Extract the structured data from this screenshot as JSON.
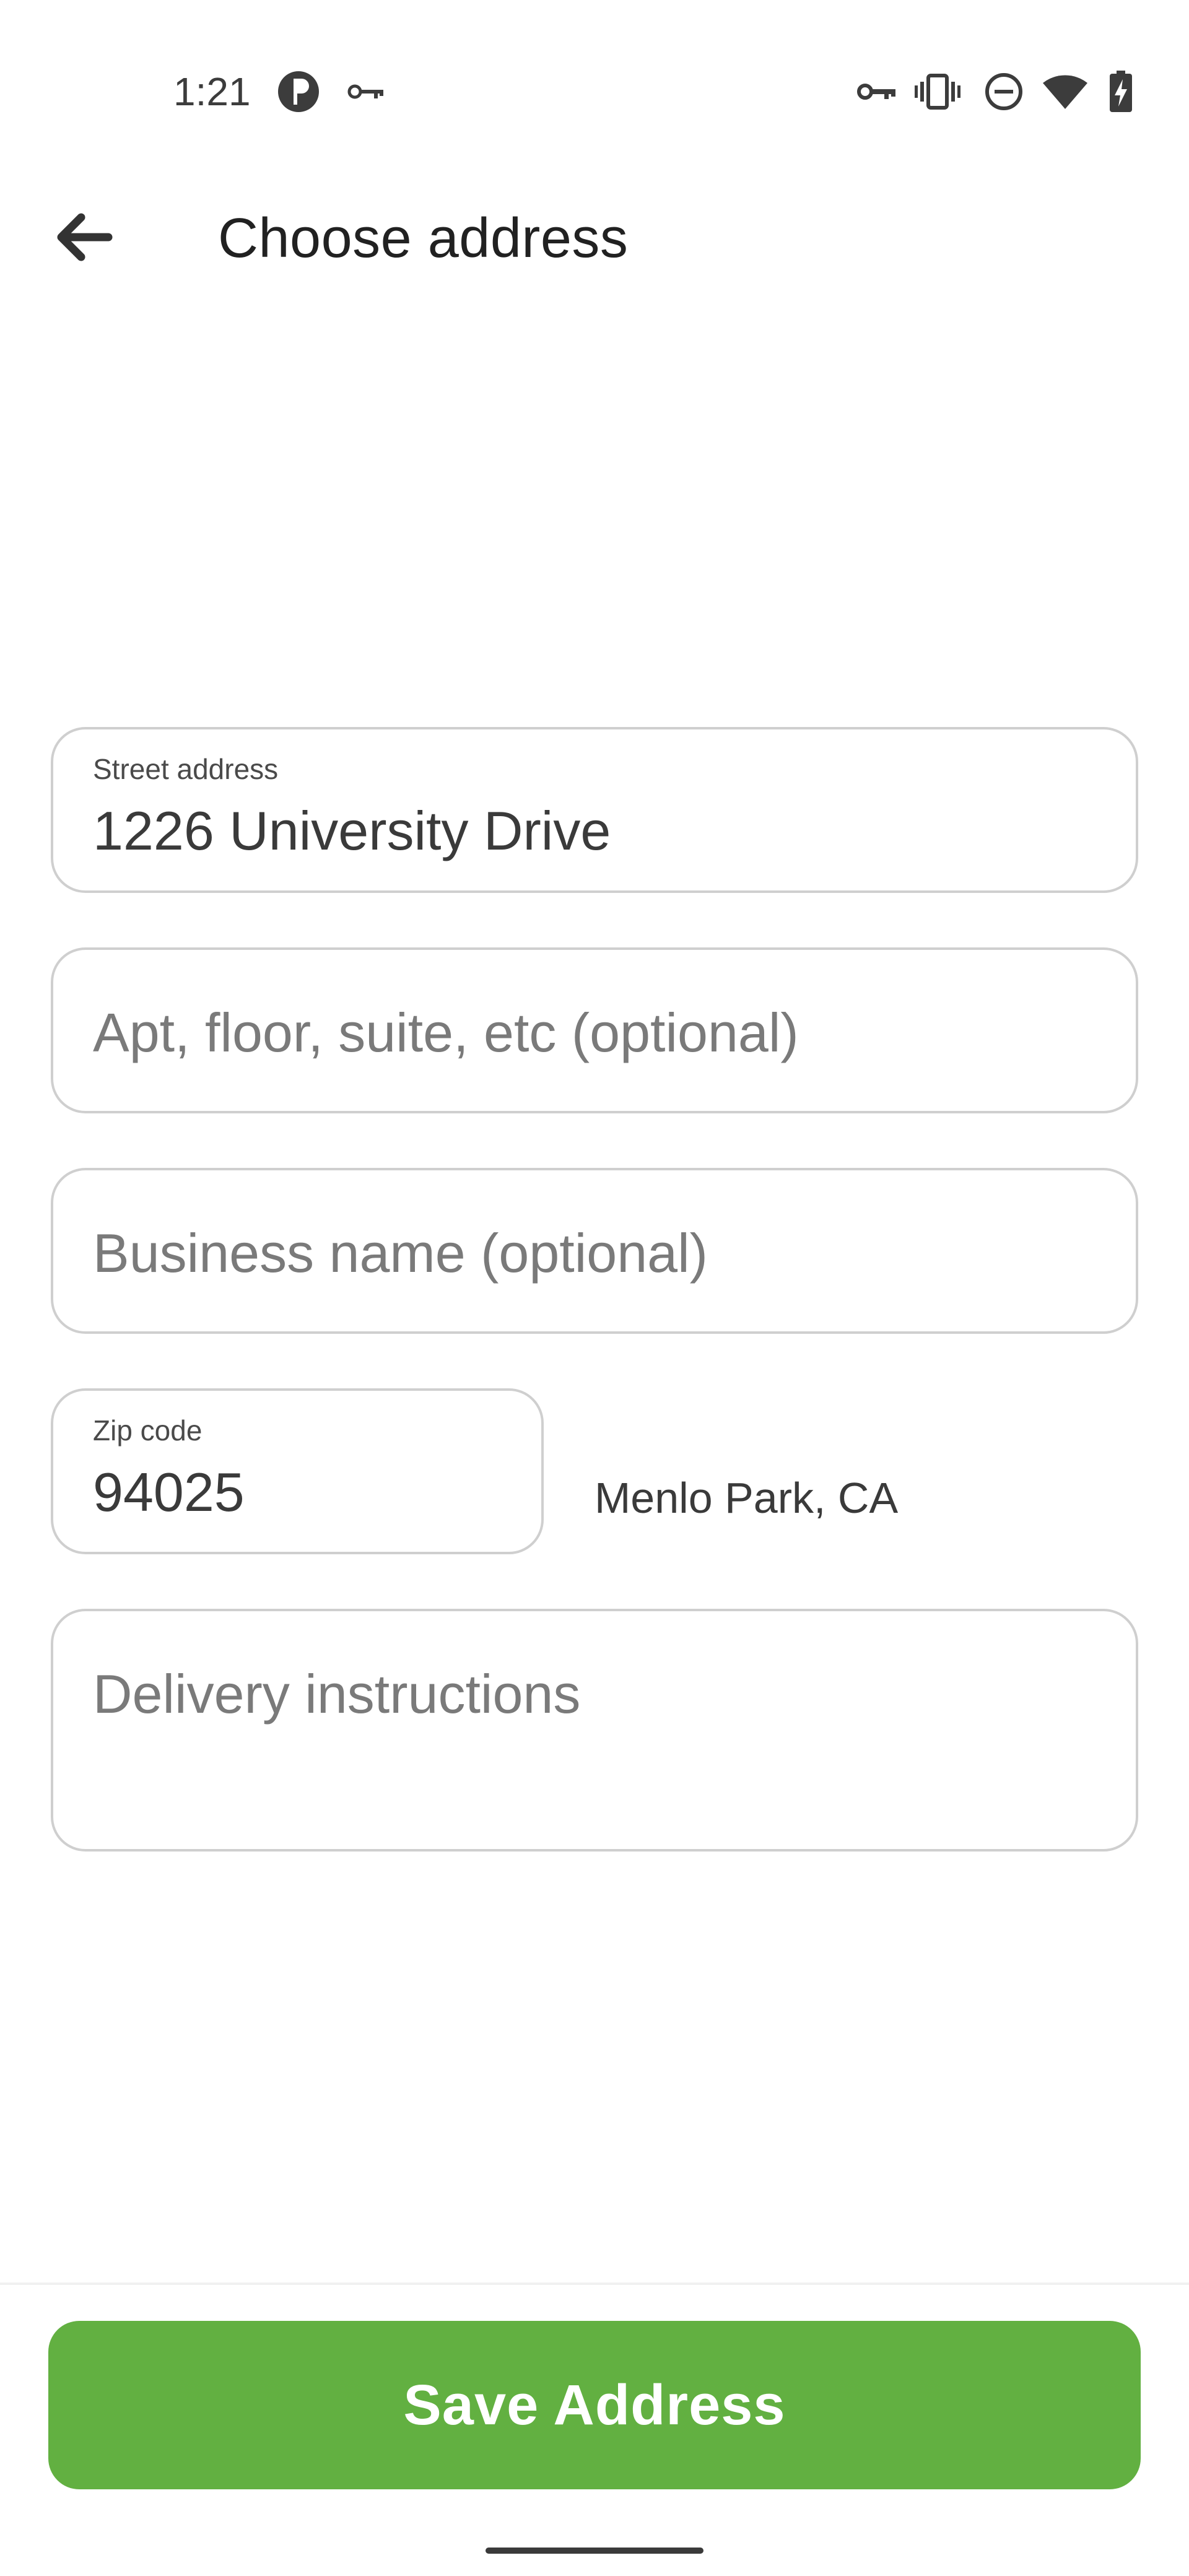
{
  "status_bar": {
    "time": "1:21",
    "left_icons": [
      "app-badge-icon",
      "vpn-key-icon"
    ],
    "right_icons": [
      "vpn-key-icon",
      "vibrate-icon",
      "do-not-disturb-icon",
      "wifi-icon",
      "battery-charging-icon"
    ]
  },
  "app_bar": {
    "back_icon": "arrow-back-icon",
    "title": "Choose address"
  },
  "form": {
    "street": {
      "label": "Street address",
      "value": "1226 University Drive"
    },
    "apt": {
      "placeholder": "Apt, floor, suite, etc (optional)"
    },
    "business": {
      "placeholder": "Business name (optional)"
    },
    "zip": {
      "label": "Zip code",
      "value": "94025"
    },
    "city": "Menlo Park, CA",
    "instructions": {
      "placeholder": "Delivery instructions"
    }
  },
  "actions": {
    "save_label": "Save Address"
  },
  "colors": {
    "primary_button": "#62b041",
    "field_border": "#cfcfcf",
    "placeholder_text": "#7a7a7a"
  }
}
